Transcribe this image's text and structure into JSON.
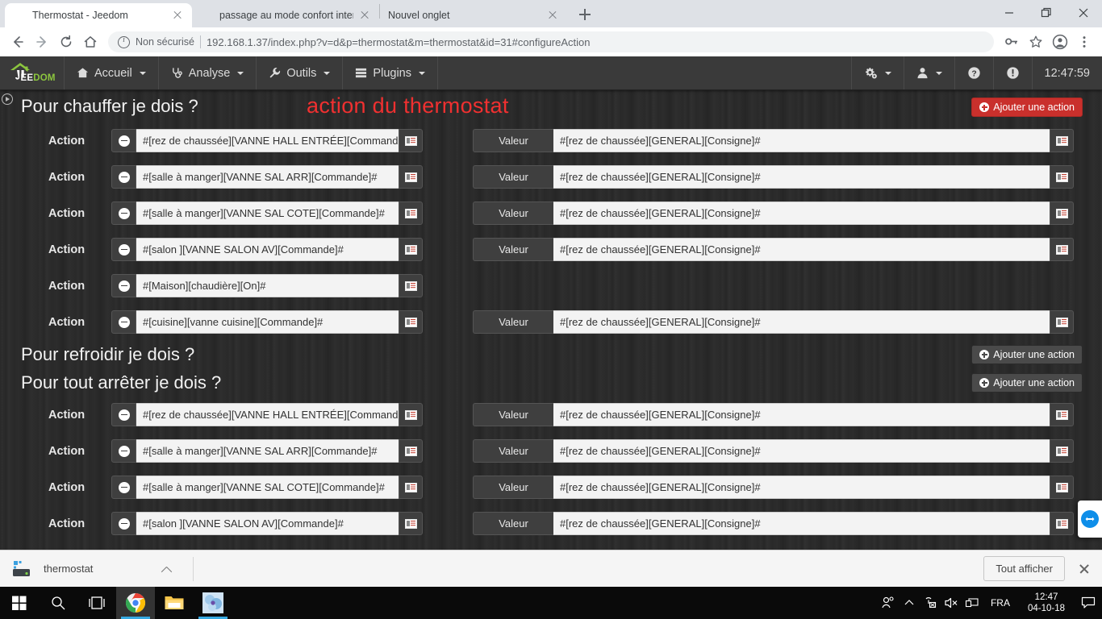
{
  "browser": {
    "tabs": [
      {
        "title": "Thermostat - Jeedom",
        "active": true,
        "favicon": "jeedom-icon"
      },
      {
        "title": "passage au mode confort intemp",
        "active": false,
        "favicon": "jeedom-icon"
      },
      {
        "title": "Nouvel onglet",
        "active": false,
        "favicon": "none"
      }
    ],
    "window_controls": {
      "minimize": "minimize-icon",
      "maximize": "maximize-icon",
      "close": "close-icon"
    },
    "new_tab_label": "+",
    "nav": {
      "back": "back-arrow-icon",
      "forward": "forward-arrow-icon",
      "reload": "reload-icon",
      "home": "home-icon"
    },
    "omnibox": {
      "security_label": "Non sécurisé",
      "url_host": "192.168.1.37",
      "url_path": "/index.php?v=d&p=thermostat&m=thermostat&id=31#configureAction",
      "full_url": "192.168.1.37/index.php?v=d&p=thermostat&m=thermostat&id=31#configureAction"
    },
    "toolbar_icons": [
      "key-icon",
      "bookmark-star-icon",
      "profile-avatar-icon",
      "chrome-menu-icon"
    ]
  },
  "jeedom": {
    "brand": {
      "name_first": "EE",
      "name_second": "DOM"
    },
    "menu": [
      {
        "label": "Accueil",
        "icon": "home-icon",
        "caret": true
      },
      {
        "label": "Analyse",
        "icon": "stethoscope-icon",
        "caret": true
      },
      {
        "label": "Outils",
        "icon": "wrench-icon",
        "caret": true
      },
      {
        "label": "Plugins",
        "icon": "plugins-list-icon",
        "caret": true
      }
    ],
    "menu_right": [
      {
        "icon": "gears-icon",
        "caret": true
      },
      {
        "icon": "user-icon",
        "caret": true
      },
      {
        "icon": "help-circle-icon",
        "caret": false
      },
      {
        "icon": "alert-circle-icon",
        "caret": false
      }
    ],
    "clock": "12:47:59",
    "annotation": "action du thermostat",
    "annotation_color": "#f03030",
    "accent_danger": "#c9302c",
    "labels": {
      "action": "Action",
      "valeur": "Valeur",
      "add_action": "Ajouter une action"
    },
    "sections": [
      {
        "title": "Pour chauffer je dois ?",
        "add_button": {
          "label": "Ajouter une action",
          "style": "danger"
        },
        "rows": [
          {
            "action": "#[rez de chaussée][VANNE HALL ENTRÉE][Commande]#",
            "valeur_label": "Valeur",
            "valeur": "#[rez de chaussée][GENERAL][Consigne]#"
          },
          {
            "action": "#[salle à manger][VANNE SAL ARR][Commande]#",
            "valeur_label": "Valeur",
            "valeur": "#[rez de chaussée][GENERAL][Consigne]#"
          },
          {
            "action": "#[salle à manger][VANNE SAL COTE][Commande]#",
            "valeur_label": "Valeur",
            "valeur": "#[rez de chaussée][GENERAL][Consigne]#"
          },
          {
            "action": "#[salon ][VANNE SALON AV][Commande]#",
            "valeur_label": "Valeur",
            "valeur": "#[rez de chaussée][GENERAL][Consigne]#"
          },
          {
            "action": "#[Maison][chaudière][On]#",
            "valeur_label": null,
            "valeur": null
          },
          {
            "action": "#[cuisine][vanne cuisine][Commande]#",
            "valeur_label": "Valeur",
            "valeur": "#[rez de chaussée][GENERAL][Consigne]#"
          }
        ]
      },
      {
        "title": "Pour refroidir je dois ?",
        "add_button": {
          "label": "Ajouter une action",
          "style": "default"
        },
        "rows": []
      },
      {
        "title": "Pour tout arrêter je dois ?",
        "add_button": {
          "label": "Ajouter une action",
          "style": "default"
        },
        "rows": [
          {
            "action": "#[rez de chaussée][VANNE HALL ENTRÉE][Commande]#",
            "valeur_label": "Valeur",
            "valeur": "#[rez de chaussée][GENERAL][Consigne]#"
          },
          {
            "action": "#[salle à manger][VANNE SAL ARR][Commande]#",
            "valeur_label": "Valeur",
            "valeur": "#[rez de chaussée][GENERAL][Consigne]#"
          },
          {
            "action": "#[salle à manger][VANNE SAL COTE][Commande]#",
            "valeur_label": "Valeur",
            "valeur": "#[rez de chaussée][GENERAL][Consigne]#"
          },
          {
            "action": "#[salon ][VANNE SALON AV][Commande]#",
            "valeur_label": "Valeur",
            "valeur": "#[rez de chaussée][GENERAL][Consigne]#"
          }
        ]
      }
    ]
  },
  "download_bar": {
    "file_name": "thermostat",
    "show_all_label": "Tout afficher",
    "close_icon": "close-icon",
    "chevron_icon": "chevron-up-icon"
  },
  "taskbar": {
    "start": "windows-start-icon",
    "search": "search-icon",
    "task_view": "task-view-icon",
    "apps": [
      {
        "name": "chrome-icon",
        "active": true
      },
      {
        "name": "file-explorer-icon",
        "active": false
      },
      {
        "name": "photos-app-icon",
        "active": true
      }
    ],
    "tray": [
      "people-icon",
      "show-hidden-icons-icon",
      "network-disconnected-icon",
      "volume-muted-icon",
      "display-icon"
    ],
    "language": "FRA",
    "time": "12:47",
    "date": "04-10-18",
    "notifications": "notification-icon"
  },
  "teamviewer_widget": {
    "icon": "teamviewer-arrows-icon"
  }
}
